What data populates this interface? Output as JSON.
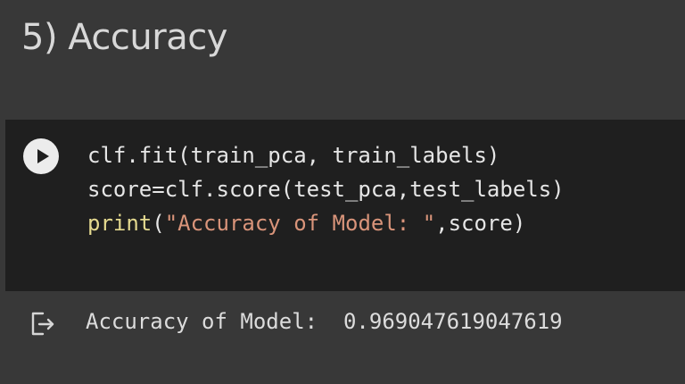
{
  "heading": "5) Accuracy",
  "cell": {
    "code_lines": [
      {
        "plain": "clf.fit(train_pca, train_labels)"
      },
      {
        "plain": "score=clf.score(test_pca,test_labels)"
      },
      {
        "func": "print",
        "open": "(",
        "string": "\"Accuracy of Model: \"",
        "rest": ",score)"
      }
    ],
    "run_icon": "play-icon"
  },
  "output": {
    "icon": "output-arrow-icon",
    "text": "Accuracy of Model:  0.969047619047619"
  },
  "colors": {
    "page_bg": "#383838",
    "cell_bg": "#1f1f1f",
    "code_text": "#e6e6e6",
    "builtin": "#e4d98f",
    "string": "#d9947a"
  }
}
